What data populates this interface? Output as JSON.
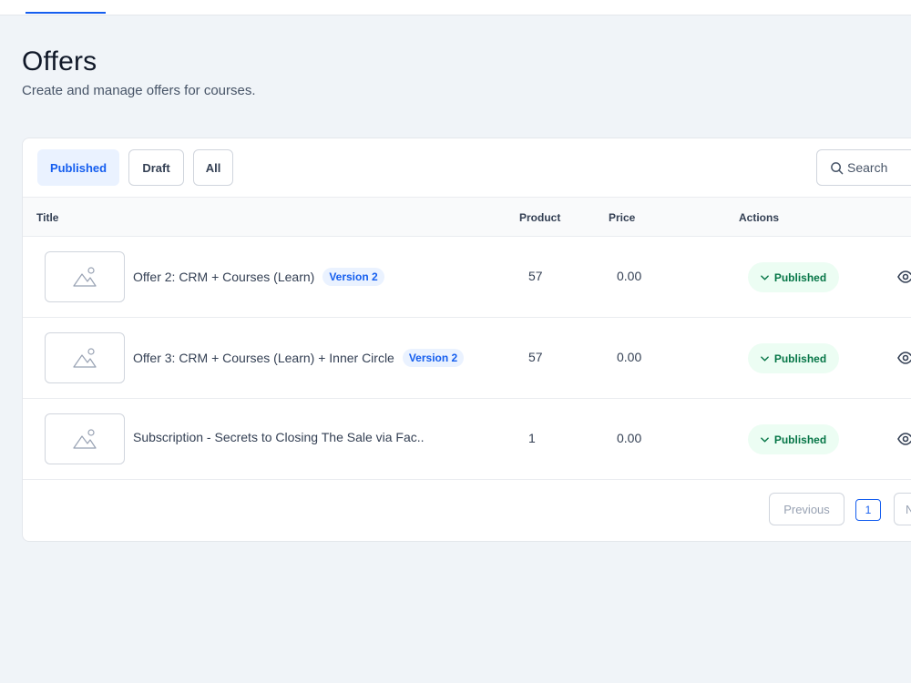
{
  "header": {
    "title": "Offers",
    "subtitle": "Create and manage offers for courses."
  },
  "filters": {
    "tabs": [
      {
        "label": "Published",
        "active": true
      },
      {
        "label": "Draft",
        "active": false
      },
      {
        "label": "All",
        "active": false
      }
    ],
    "search_placeholder": "Search"
  },
  "table": {
    "columns": [
      "Title",
      "Product",
      "Price",
      "Actions"
    ],
    "rows": [
      {
        "title": "Offer 2: CRM + Courses (Learn)",
        "badge": "Version 2",
        "product": "57",
        "price": "0.00",
        "status": "Published"
      },
      {
        "title": "Offer 3: CRM + Courses (Learn) + Inner Circle",
        "badge": "Version 2",
        "product": "57",
        "price": "0.00",
        "status": "Published"
      },
      {
        "title": "Subscription - Secrets to Closing The Sale via Fac..",
        "badge": "",
        "product": "1",
        "price": "0.00",
        "status": "Published"
      }
    ]
  },
  "pagination": {
    "previous_label": "Previous",
    "current_page": "1",
    "next_label": "N"
  },
  "colors": {
    "accent": "#155eef",
    "success_bg": "#ecfdf3",
    "success_text": "#067647",
    "page_bg": "#f0f4f8"
  },
  "icons": {
    "search": "search-icon",
    "placeholder": "image-placeholder-icon",
    "status": "chevron-down-icon",
    "view": "eye-icon"
  }
}
